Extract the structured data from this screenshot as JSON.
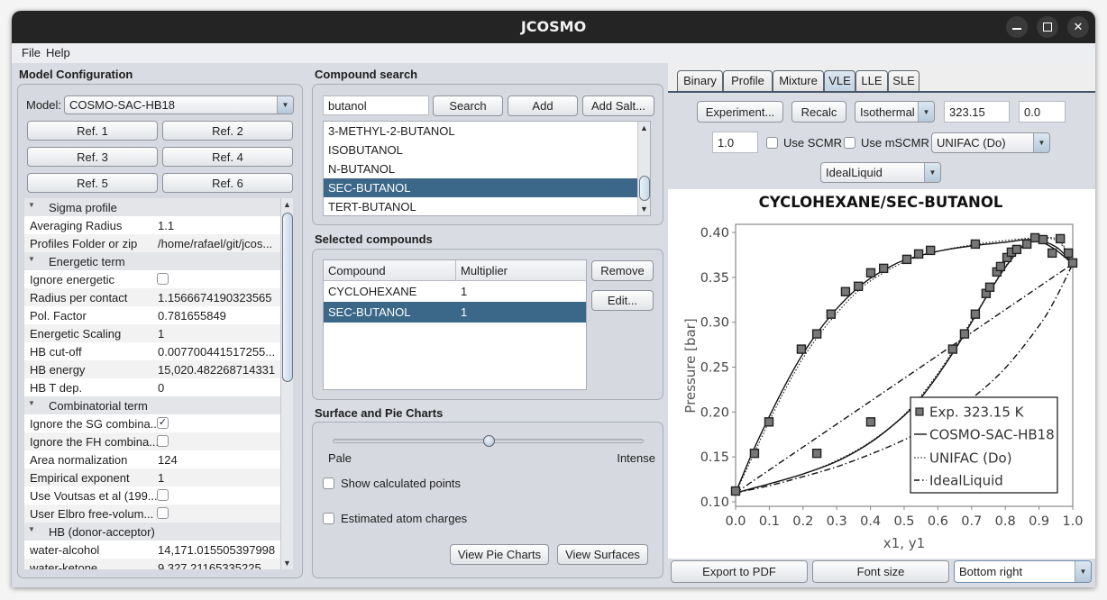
{
  "window": {
    "title": "JCOSMO"
  },
  "menu": {
    "items": [
      {
        "label": "File"
      },
      {
        "label": "Help"
      }
    ]
  },
  "model_config": {
    "title": "Model Configuration",
    "model_label": "Model:",
    "model_value": "COSMO-SAC-HB18",
    "ref_buttons": [
      "Ref. 1",
      "Ref. 2",
      "Ref. 3",
      "Ref. 4",
      "Ref. 5",
      "Ref. 6"
    ],
    "properties": [
      {
        "type": "category",
        "label": "Sigma profile"
      },
      {
        "type": "text",
        "label": "Averaging Radius",
        "value": "1.1"
      },
      {
        "type": "text",
        "label": "Profiles Folder or zip",
        "value": "/home/rafael/git/jcos..."
      },
      {
        "type": "category",
        "label": "Energetic term"
      },
      {
        "type": "checkbox",
        "label": "Ignore energetic",
        "checked": false
      },
      {
        "type": "text",
        "label": "Radius per contact",
        "value": "1.1566674190323565"
      },
      {
        "type": "text",
        "label": "Pol. Factor",
        "value": "0.781655849"
      },
      {
        "type": "text",
        "label": "Energetic Scaling",
        "value": "1"
      },
      {
        "type": "text",
        "label": "HB cut-off",
        "value": "0.007700441517255..."
      },
      {
        "type": "text",
        "label": "HB energy",
        "value": "15,020.482268714331"
      },
      {
        "type": "text",
        "label": "HB T dep.",
        "value": "0"
      },
      {
        "type": "category",
        "label": "Combinatorial term"
      },
      {
        "type": "checkbox",
        "label": "Ignore the SG combina...",
        "checked": true
      },
      {
        "type": "checkbox",
        "label": "Ignore the FH combina...",
        "checked": false
      },
      {
        "type": "text",
        "label": "Area normalization",
        "value": "124"
      },
      {
        "type": "text",
        "label": "Empirical exponent",
        "value": "1"
      },
      {
        "type": "checkbox",
        "label": "Use Voutsas et al (199...",
        "checked": false
      },
      {
        "type": "checkbox",
        "label": "User Elbro free-volum...",
        "checked": false
      },
      {
        "type": "category",
        "label": "HB (donor-acceptor)"
      },
      {
        "type": "text",
        "label": "water-alcohol",
        "value": "14,171.015505397998"
      },
      {
        "type": "text",
        "label": "water-ketone",
        "value": "9,327.21165335225"
      }
    ]
  },
  "compound_search": {
    "title": "Compound search",
    "query": "butanol",
    "search_label": "Search",
    "add_label": "Add",
    "add_salt_label": "Add Salt...",
    "results": [
      "3-METHYL-2-BUTANOL",
      "ISOBUTANOL",
      "N-BUTANOL",
      "SEC-BUTANOL",
      "TERT-BUTANOL"
    ],
    "selected": "SEC-BUTANOL"
  },
  "selected_compounds": {
    "title": "Selected compounds",
    "columns": [
      "Compound",
      "Multiplier"
    ],
    "rows": [
      [
        "CYCLOHEXANE",
        "1"
      ],
      [
        "SEC-BUTANOL",
        "1"
      ]
    ],
    "selected": "SEC-BUTANOL",
    "remove_label": "Remove",
    "edit_label": "Edit..."
  },
  "surface_pie": {
    "title": "Surface and Pie Charts",
    "color_slider": {
      "value": 0.5,
      "min_label": "Pale",
      "max_label": "Intense"
    },
    "show_calculated_points": {
      "label": "Show calculated points",
      "checked": false
    },
    "estimated_atom_charges": {
      "label": "Estimated atom charges",
      "checked": false
    },
    "view_pie_label": "View Pie Charts",
    "view_surfaces_label": "View Surfaces"
  },
  "tabs": {
    "items": [
      "Binary",
      "Profile",
      "Mixture",
      "VLE",
      "LLE",
      "SLE"
    ],
    "active": "VLE"
  },
  "vle": {
    "experiment_label": "Experiment...",
    "recalc_label": "Recalc",
    "mode": "Isothermal",
    "temperature": "323.15",
    "value2": "0.0",
    "value3": "1.0",
    "use_scmr": {
      "label": "Use SCMR",
      "checked": false
    },
    "use_mscmr": {
      "label": "Use mSCMR",
      "checked": false
    },
    "model2": "UNIFAC (Do)",
    "model3": "IdealLiquid"
  },
  "bottom": {
    "export_label": "Export to PDF",
    "font_size_label": "Font size",
    "legend_position": "Bottom right"
  },
  "chart_data": {
    "type": "line",
    "title": "CYCLOHEXANE/SEC-BUTANOL",
    "xlabel": "x1, y1",
    "ylabel": "Pressure [bar]",
    "xlim": [
      0.0,
      1.0
    ],
    "ylim": [
      0.095,
      0.409
    ],
    "xticks": [
      "0.0",
      "0.1",
      "0.2",
      "0.3",
      "0.4",
      "0.5",
      "0.6",
      "0.7",
      "0.8",
      "0.9",
      "1.0"
    ],
    "yticks": [
      "0.10",
      "0.15",
      "0.20",
      "0.25",
      "0.30",
      "0.35",
      "0.40"
    ],
    "grid": false,
    "legend_position": "bottom-right",
    "legend": [
      "Exp. 323.15 K",
      "COSMO-SAC-HB18",
      "UNIFAC (Do)",
      "IdealLiquid"
    ],
    "experimental": {
      "name": "Exp. 323.15 K",
      "points": [
        [
          0.0,
          0.112
        ],
        [
          0.056,
          0.154
        ],
        [
          0.099,
          0.189
        ],
        [
          0.195,
          0.27
        ],
        [
          0.241,
          0.287
        ],
        [
          0.283,
          0.309
        ],
        [
          0.326,
          0.334
        ],
        [
          0.364,
          0.34
        ],
        [
          0.401,
          0.355
        ],
        [
          0.439,
          0.36
        ],
        [
          0.508,
          0.37
        ],
        [
          0.543,
          0.376
        ],
        [
          0.578,
          0.38
        ],
        [
          0.711,
          0.387
        ],
        [
          0.888,
          0.394
        ],
        [
          0.912,
          0.392
        ],
        [
          0.939,
          0.377
        ],
        [
          0.963,
          0.393
        ],
        [
          0.987,
          0.377
        ],
        [
          1.0,
          0.366
        ],
        [
          0.241,
          0.154
        ],
        [
          0.401,
          0.189
        ],
        [
          0.644,
          0.27
        ],
        [
          0.679,
          0.287
        ],
        [
          0.711,
          0.309
        ],
        [
          0.743,
          0.332
        ],
        [
          0.754,
          0.339
        ],
        [
          0.775,
          0.356
        ],
        [
          0.786,
          0.362
        ],
        [
          0.805,
          0.372
        ],
        [
          0.818,
          0.378
        ],
        [
          0.834,
          0.381
        ],
        [
          0.864,
          0.387
        ]
      ]
    },
    "series": [
      {
        "name": "COSMO-SAC-HB18",
        "line_style": "solid",
        "dew": [
          [
            0,
            0.11
          ],
          [
            0.05,
            0.155
          ],
          [
            0.1,
            0.195
          ],
          [
            0.15,
            0.232
          ],
          [
            0.2,
            0.265
          ],
          [
            0.25,
            0.292
          ],
          [
            0.3,
            0.315
          ],
          [
            0.35,
            0.334
          ],
          [
            0.4,
            0.349
          ],
          [
            0.45,
            0.36
          ],
          [
            0.5,
            0.369
          ],
          [
            0.6,
            0.379
          ],
          [
            0.7,
            0.385
          ],
          [
            0.8,
            0.389
          ],
          [
            0.88,
            0.392
          ],
          [
            0.95,
            0.384
          ],
          [
            1.0,
            0.365
          ]
        ],
        "bubble": [
          [
            0,
            0.11
          ],
          [
            0.1,
            0.12
          ],
          [
            0.2,
            0.131
          ],
          [
            0.3,
            0.145
          ],
          [
            0.4,
            0.166
          ],
          [
            0.5,
            0.196
          ],
          [
            0.55,
            0.216
          ],
          [
            0.6,
            0.241
          ],
          [
            0.65,
            0.269
          ],
          [
            0.7,
            0.3
          ],
          [
            0.75,
            0.332
          ],
          [
            0.8,
            0.361
          ],
          [
            0.85,
            0.384
          ],
          [
            0.88,
            0.392
          ],
          [
            0.94,
            0.383
          ],
          [
            1.0,
            0.365
          ]
        ]
      },
      {
        "name": "UNIFAC (Do)",
        "line_style": "dotted",
        "dew": [
          [
            0,
            0.11
          ],
          [
            0.05,
            0.15
          ],
          [
            0.1,
            0.19
          ],
          [
            0.15,
            0.227
          ],
          [
            0.2,
            0.26
          ],
          [
            0.25,
            0.287
          ],
          [
            0.3,
            0.31
          ],
          [
            0.35,
            0.33
          ],
          [
            0.4,
            0.346
          ],
          [
            0.5,
            0.367
          ],
          [
            0.6,
            0.379
          ],
          [
            0.7,
            0.386
          ],
          [
            0.8,
            0.391
          ],
          [
            0.9,
            0.394
          ],
          [
            0.96,
            0.391
          ],
          [
            1.0,
            0.365
          ]
        ],
        "bubble": [
          [
            0,
            0.11
          ],
          [
            0.1,
            0.12
          ],
          [
            0.2,
            0.131
          ],
          [
            0.3,
            0.146
          ],
          [
            0.4,
            0.167
          ],
          [
            0.5,
            0.197
          ],
          [
            0.6,
            0.243
          ],
          [
            0.7,
            0.302
          ],
          [
            0.8,
            0.362
          ],
          [
            0.85,
            0.384
          ],
          [
            0.9,
            0.394
          ],
          [
            0.96,
            0.389
          ],
          [
            1.0,
            0.365
          ]
        ]
      },
      {
        "name": "IdealLiquid",
        "line_style": "dashdot",
        "dew": [
          [
            0,
            0.11
          ],
          [
            0.1,
            0.118
          ],
          [
            0.2,
            0.128
          ],
          [
            0.3,
            0.139
          ],
          [
            0.4,
            0.153
          ],
          [
            0.5,
            0.169
          ],
          [
            0.6,
            0.189
          ],
          [
            0.7,
            0.215
          ],
          [
            0.8,
            0.249
          ],
          [
            0.9,
            0.296
          ],
          [
            0.95,
            0.327
          ],
          [
            1.0,
            0.365
          ]
        ],
        "bubble": [
          [
            0,
            0.11
          ],
          [
            1.0,
            0.365
          ]
        ]
      }
    ]
  }
}
